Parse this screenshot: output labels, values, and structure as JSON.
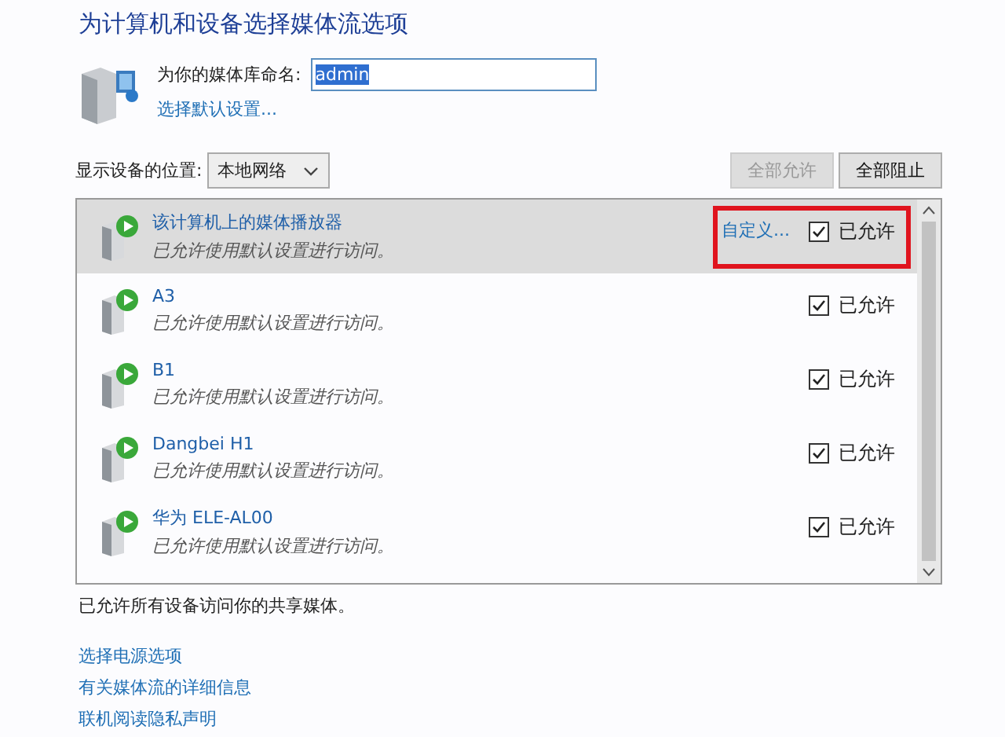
{
  "title": "为计算机和设备选择媒体流选项",
  "library": {
    "label": "为你的媒体库命名:",
    "value": "admin",
    "value_selected": true,
    "link": "选择默认设置..."
  },
  "location": {
    "label": "显示设备的位置:",
    "value": "本地网络"
  },
  "buttons": [
    {
      "label": "全部允许",
      "disabled": true
    },
    {
      "label": "全部阻止",
      "disabled": false
    }
  ],
  "devices": [
    {
      "name": "该计算机上的媒体播放器",
      "status": "已允许使用默认设置进行访问。",
      "action": "自定义...",
      "checkbox_label": "已允许",
      "checked": true,
      "selected": true,
      "highlighted": true
    },
    {
      "name": "A3",
      "status": "已允许使用默认设置进行访问。",
      "checkbox_label": "已允许",
      "checked": true,
      "selected": false,
      "highlighted": false
    },
    {
      "name": "B1",
      "status": "已允许使用默认设置进行访问。",
      "checkbox_label": "已允许",
      "checked": true,
      "selected": false,
      "highlighted": false
    },
    {
      "name": "Dangbei H1",
      "status": "已允许使用默认设置进行访问。",
      "checkbox_label": "已允许",
      "checked": true,
      "selected": false,
      "highlighted": false
    },
    {
      "name": "华为 ELE-AL00",
      "status": "已允许使用默认设置进行访问。",
      "checkbox_label": "已允许",
      "checked": true,
      "selected": false,
      "highlighted": false
    }
  ],
  "summary": "已允许所有设备访问你的共享媒体。",
  "links": [
    "选择电源选项",
    "有关媒体流的详细信息",
    "联机阅读隐私声明"
  ]
}
